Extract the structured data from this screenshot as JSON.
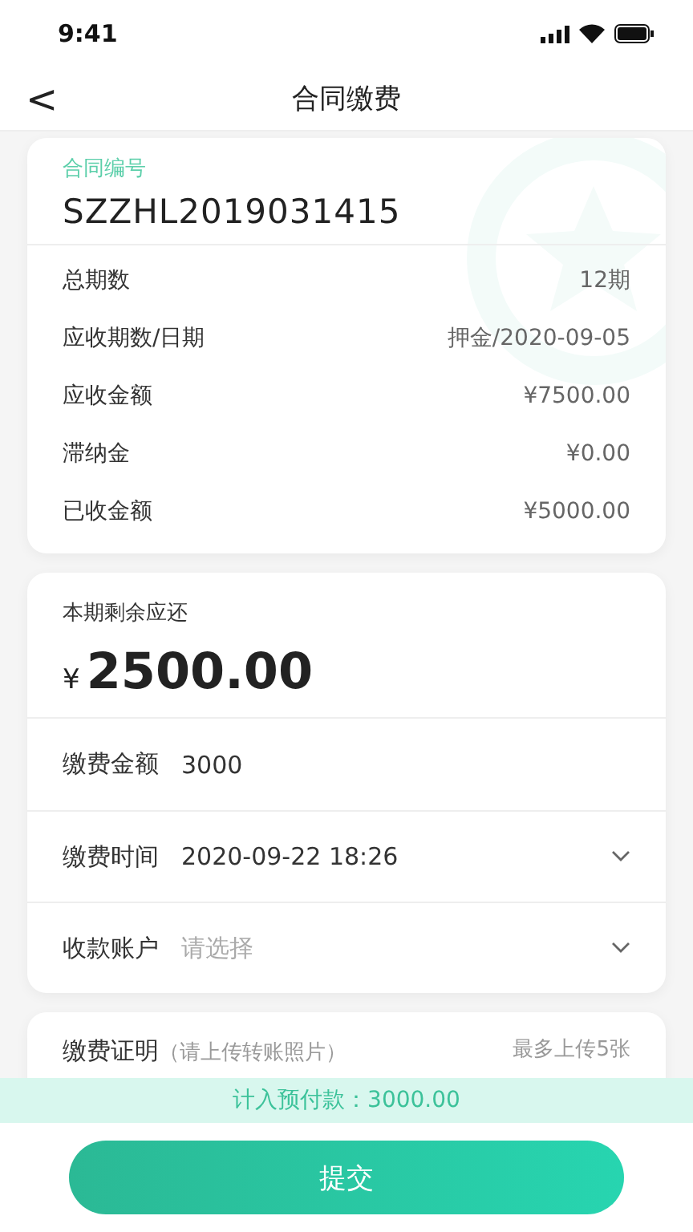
{
  "status_bar": {
    "time": "9:41"
  },
  "nav": {
    "back": "<",
    "title": "合同缴费"
  },
  "contract": {
    "label": "合同编号",
    "number": "SZZHL2019031415",
    "rows": [
      {
        "label": "总期数",
        "value": "12期"
      },
      {
        "label": "应收期数/日期",
        "value": "押金/2020-09-05"
      },
      {
        "label": "应收金额",
        "value": "¥7500.00"
      },
      {
        "label": "滞纳金",
        "value": "¥0.00"
      },
      {
        "label": "已收金额",
        "value": "¥5000.00"
      }
    ]
  },
  "payment": {
    "remaining_label": "本期剩余应还",
    "currency": "¥",
    "remaining": "2500.00",
    "fields": [
      {
        "kind": "input",
        "label": "缴费金额",
        "value": "3000"
      },
      {
        "kind": "select",
        "label": "缴费时间",
        "value": "2020-09-22 18:26"
      },
      {
        "kind": "select",
        "label": "收款账户",
        "placeholder": "请选择"
      }
    ]
  },
  "proof": {
    "label": "缴费证明",
    "hint": "（请上传转账照片）",
    "limit": "最多上传5张"
  },
  "prepay_banner": "计入预付款：3000.00",
  "submit": "提交"
}
